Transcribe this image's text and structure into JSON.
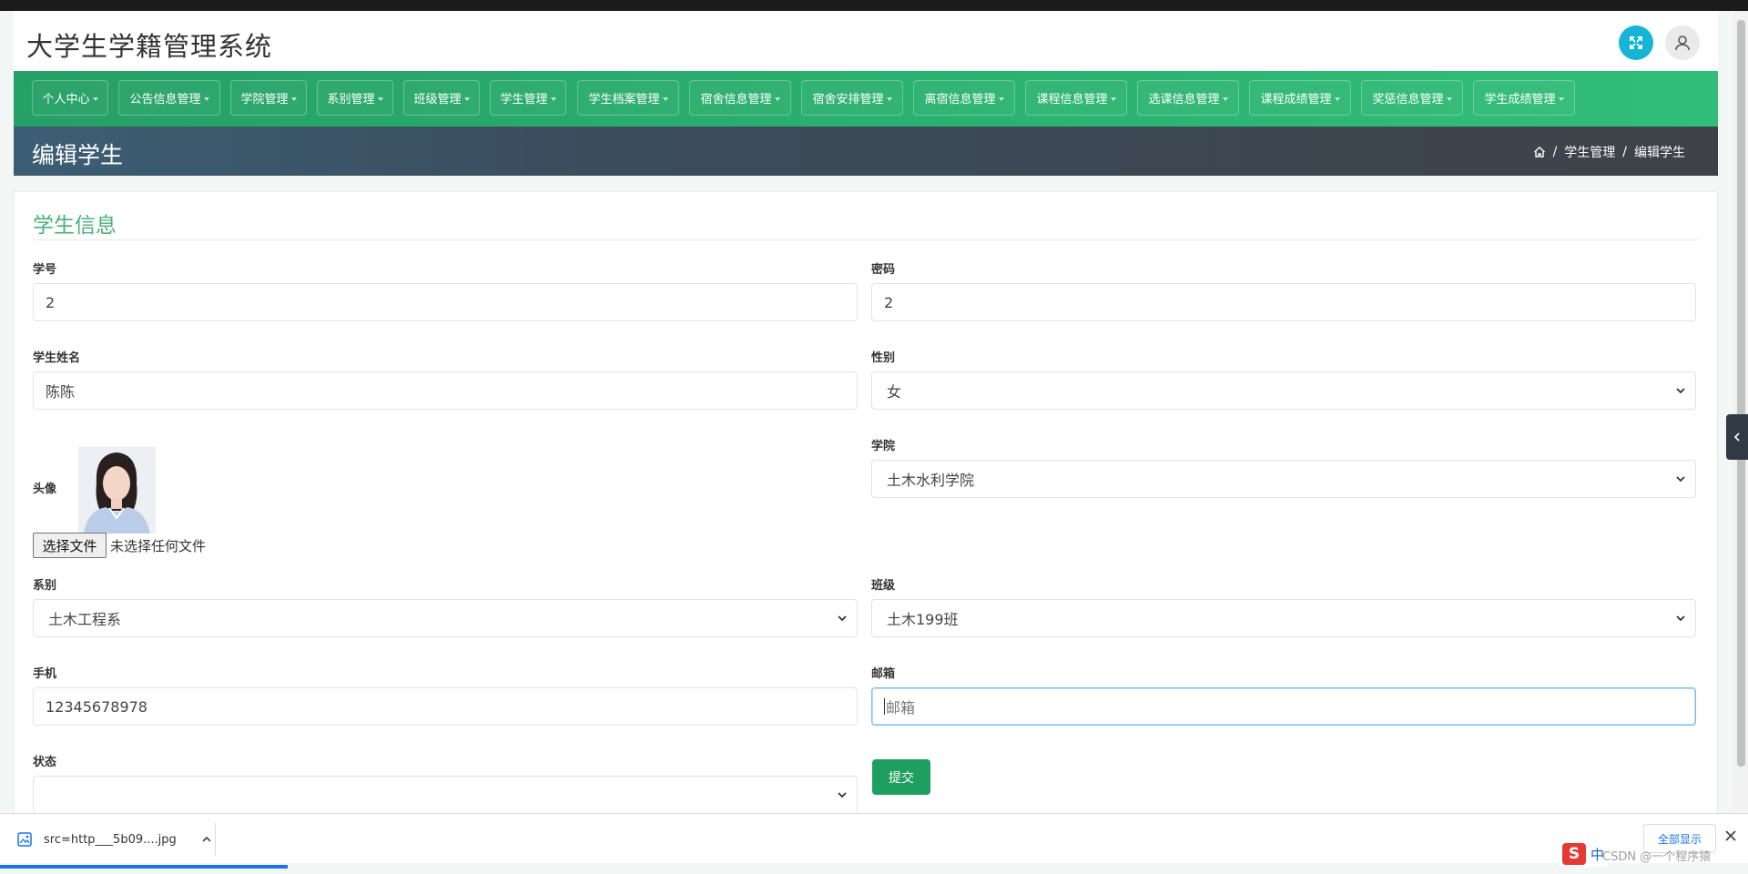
{
  "app": {
    "title": "大学生学籍管理系统"
  },
  "nav": {
    "items": [
      {
        "label": "个人中心"
      },
      {
        "label": "公告信息管理"
      },
      {
        "label": "学院管理"
      },
      {
        "label": "系别管理"
      },
      {
        "label": "班级管理"
      },
      {
        "label": "学生管理"
      },
      {
        "label": "学生档案管理"
      },
      {
        "label": "宿舍信息管理"
      },
      {
        "label": "宿舍安排管理"
      },
      {
        "label": "离宿信息管理"
      },
      {
        "label": "课程信息管理"
      },
      {
        "label": "选课信息管理"
      },
      {
        "label": "课程成绩管理"
      },
      {
        "label": "奖惩信息管理"
      },
      {
        "label": "学生成绩管理"
      }
    ]
  },
  "page": {
    "heading": "编辑学生"
  },
  "breadcrumb": {
    "home_icon": "home-icon",
    "section": "学生管理",
    "current": "编辑学生"
  },
  "form": {
    "title": "学生信息",
    "student_id": {
      "label": "学号",
      "value": "2"
    },
    "password": {
      "label": "密码",
      "value": "2"
    },
    "name": {
      "label": "学生姓名",
      "value": "陈陈"
    },
    "gender": {
      "label": "性别",
      "value": "女"
    },
    "avatar": {
      "label": "头像",
      "file_button": "选择文件",
      "file_status": "未选择任何文件"
    },
    "college": {
      "label": "学院",
      "value": "土木水利学院"
    },
    "department": {
      "label": "系别",
      "value": "土木工程系"
    },
    "class": {
      "label": "班级",
      "value": "土木199班"
    },
    "phone": {
      "label": "手机",
      "value": "12345678978"
    },
    "email": {
      "label": "邮箱",
      "placeholder": "邮箱",
      "value": ""
    },
    "status": {
      "label": "状态",
      "value": ""
    },
    "submit_label": "提交"
  },
  "download_bar": {
    "file_name": "src=http___5b09....jpg",
    "show_all": "全部显示"
  },
  "ime": {
    "logo": "S",
    "mode": "中"
  },
  "watermark": "CSDN @一个程序猿",
  "colors": {
    "nav_green": "#2bb371",
    "heading_green": "#4caf7a",
    "submit_green": "#1e9e5f",
    "expand_cyan": "#16b5d8"
  }
}
